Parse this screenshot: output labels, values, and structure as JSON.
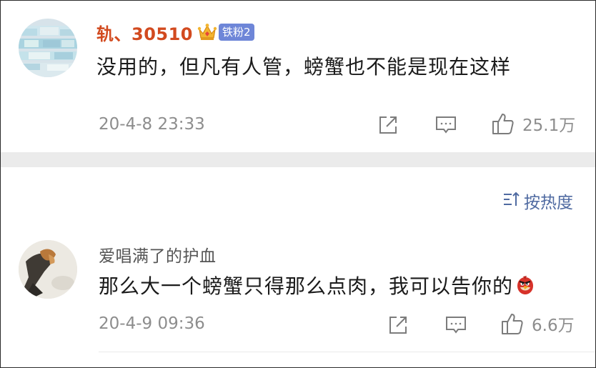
{
  "comments": [
    {
      "username": "轨、30510",
      "badge": "铁粉2",
      "badge_icon": "crown-icon",
      "text": "没用的，但凡有人管，螃蟹也不能是现在这样",
      "timestamp": "20-4-8 23:33",
      "likes": "25.1万"
    },
    {
      "username": "爱唱满了的护血",
      "text": "那么大一个螃蟹只得那么点肉，我可以告你的",
      "emoji": "angry-bird-emoji",
      "timestamp": "20-4-9 09:36",
      "likes": "6.6万"
    }
  ],
  "sort": {
    "label": "按热度",
    "icon": "sort-icon"
  },
  "colors": {
    "vip_name": "#d24a1f",
    "badge_bg": "#6e86d8",
    "link_blue": "#4f6aa1",
    "meta_gray": "#8d8d8d",
    "divider": "#ebebeb"
  }
}
